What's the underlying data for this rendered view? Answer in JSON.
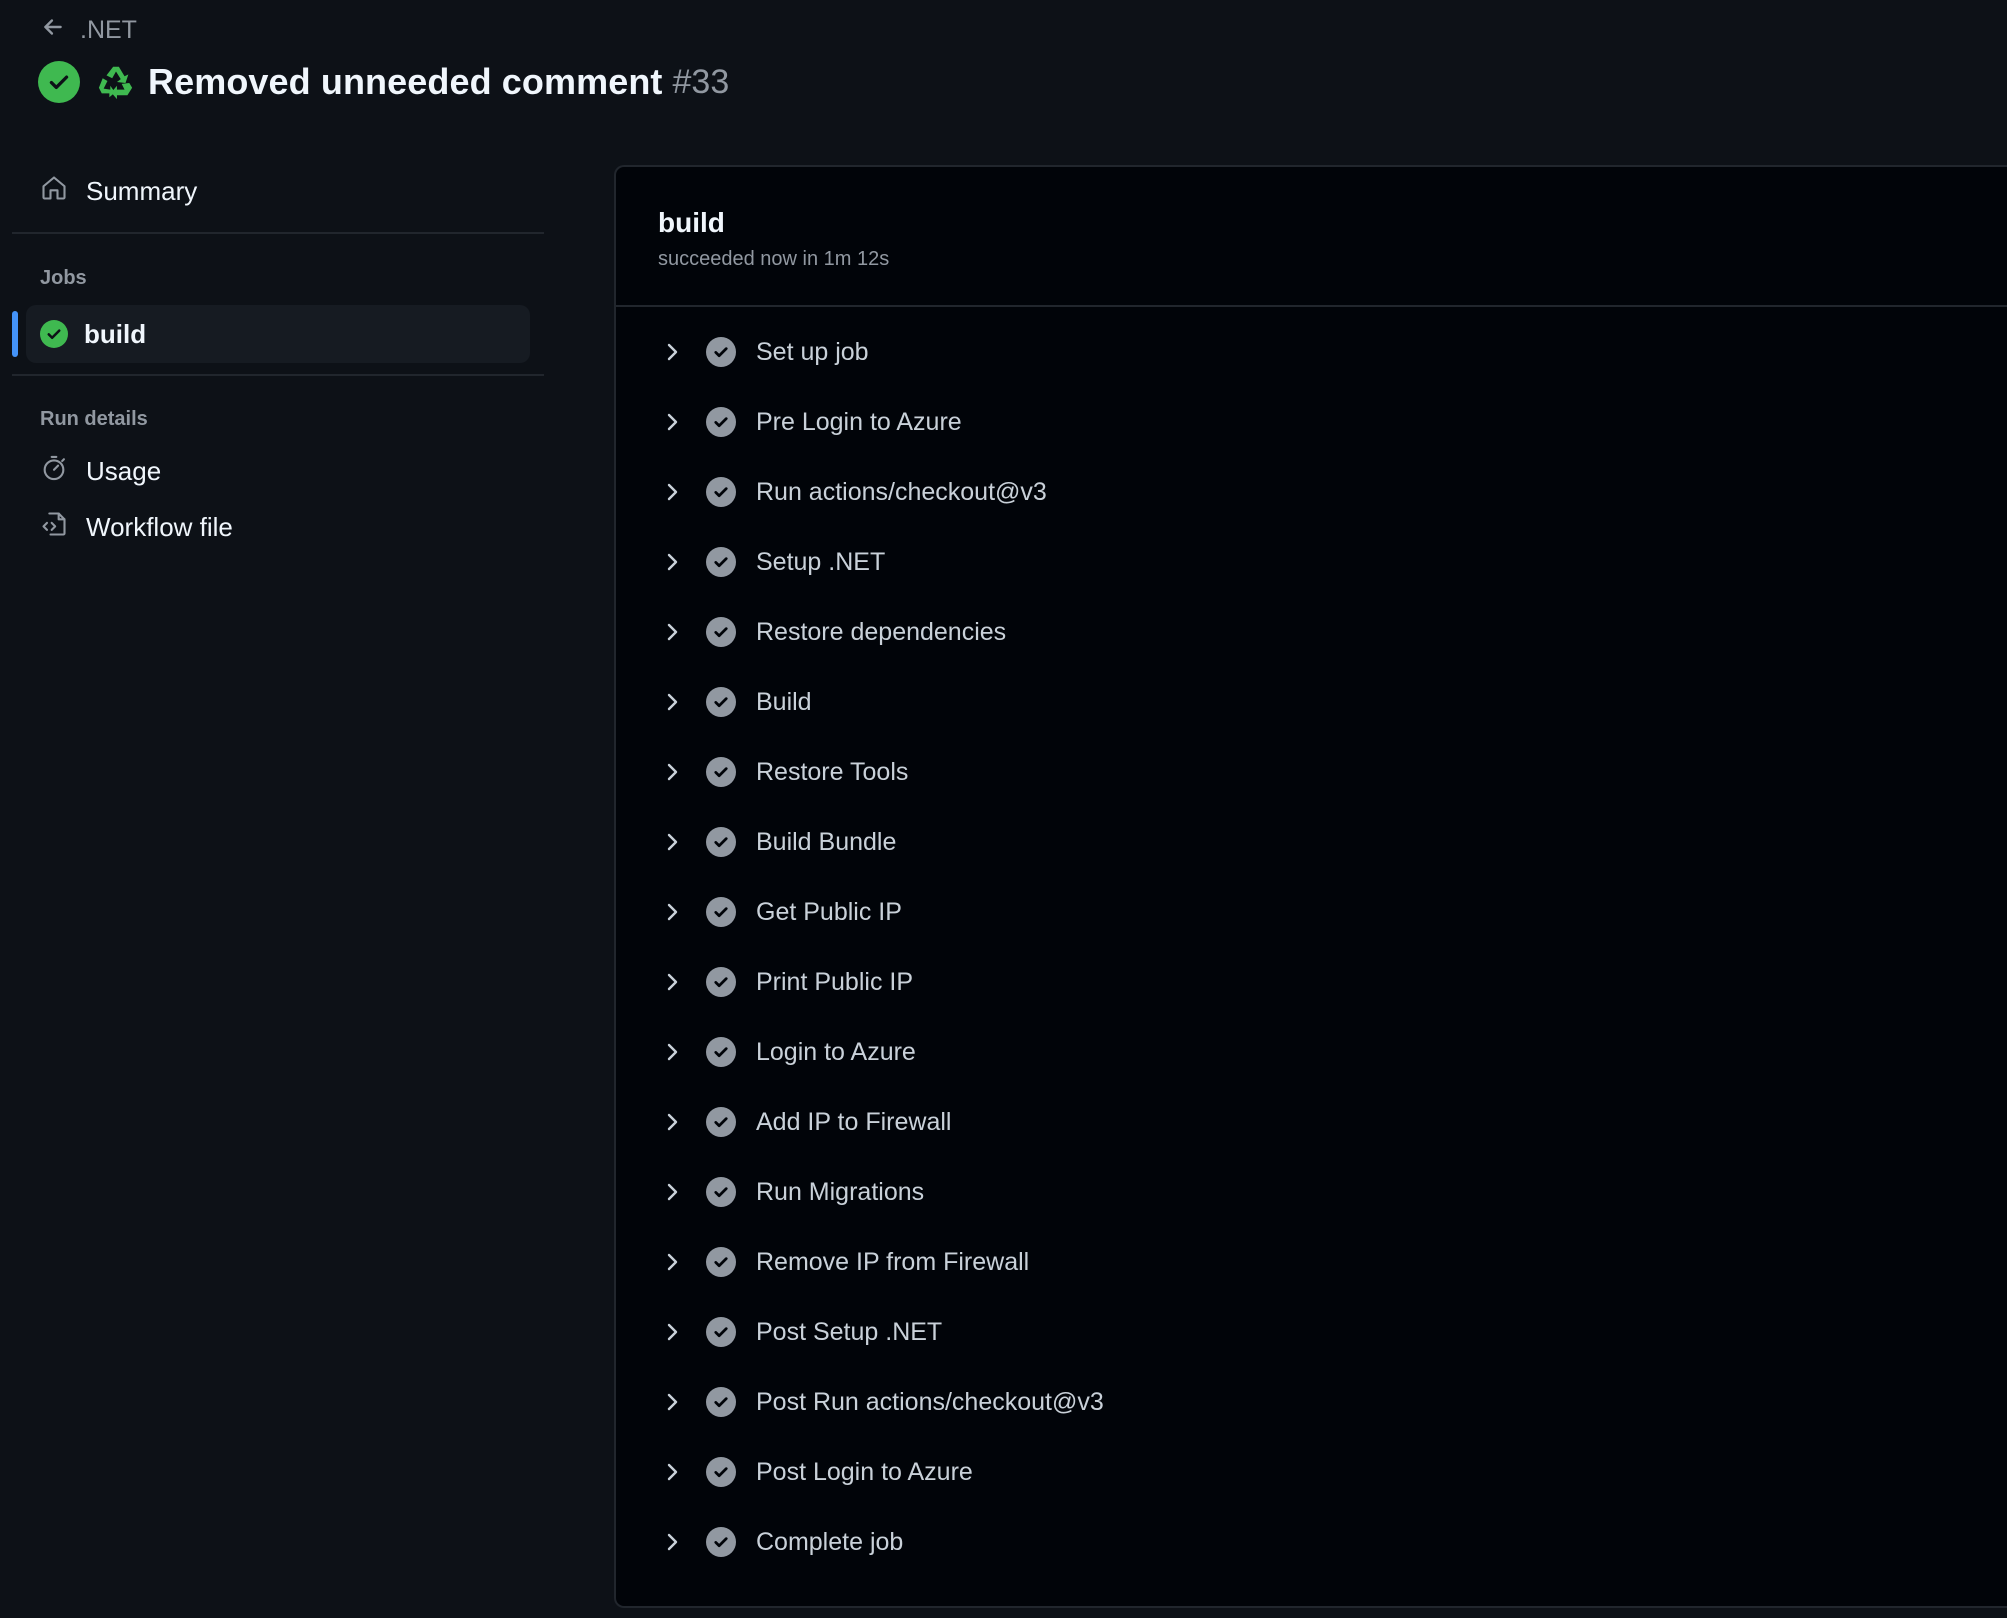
{
  "header": {
    "back_label": ".NET",
    "title": "Removed unneeded comment",
    "run_number": "#33",
    "status": "success"
  },
  "sidebar": {
    "summary_label": "Summary",
    "jobs_heading": "Jobs",
    "jobs": [
      {
        "label": "build",
        "status": "success",
        "selected": true
      }
    ],
    "run_details_heading": "Run details",
    "usage_label": "Usage",
    "workflow_file_label": "Workflow file"
  },
  "job": {
    "title": "build",
    "subtitle": "succeeded now in 1m 12s",
    "steps": [
      {
        "label": "Set up job",
        "status": "success"
      },
      {
        "label": "Pre Login to Azure",
        "status": "success"
      },
      {
        "label": "Run actions/checkout@v3",
        "status": "success"
      },
      {
        "label": "Setup .NET",
        "status": "success"
      },
      {
        "label": "Restore dependencies",
        "status": "success"
      },
      {
        "label": "Build",
        "status": "success"
      },
      {
        "label": "Restore Tools",
        "status": "success"
      },
      {
        "label": "Build Bundle",
        "status": "success"
      },
      {
        "label": "Get Public IP",
        "status": "success"
      },
      {
        "label": "Print Public IP",
        "status": "success"
      },
      {
        "label": "Login to Azure",
        "status": "success"
      },
      {
        "label": "Add IP to Firewall",
        "status": "success"
      },
      {
        "label": "Run Migrations",
        "status": "success"
      },
      {
        "label": "Remove IP from Firewall",
        "status": "success"
      },
      {
        "label": "Post Setup .NET",
        "status": "success"
      },
      {
        "label": "Post Run actions/checkout@v3",
        "status": "success"
      },
      {
        "label": "Post Login to Azure",
        "status": "success"
      },
      {
        "label": "Complete job",
        "status": "success"
      }
    ]
  },
  "colors": {
    "success_green": "#3fb950",
    "step_check_gray": "#9198a1",
    "accent_blue": "#4493f8",
    "background": "#0d1117",
    "panel_background": "#010409"
  },
  "icons": {
    "back": "arrow-left-icon",
    "status": "check-circle-icon",
    "event": "recycle-icon",
    "summary": "home-icon",
    "usage": "stopwatch-icon",
    "workflow_file": "file-code-icon",
    "step_expand": "chevron-right-icon",
    "step_status": "check-circle-icon"
  }
}
